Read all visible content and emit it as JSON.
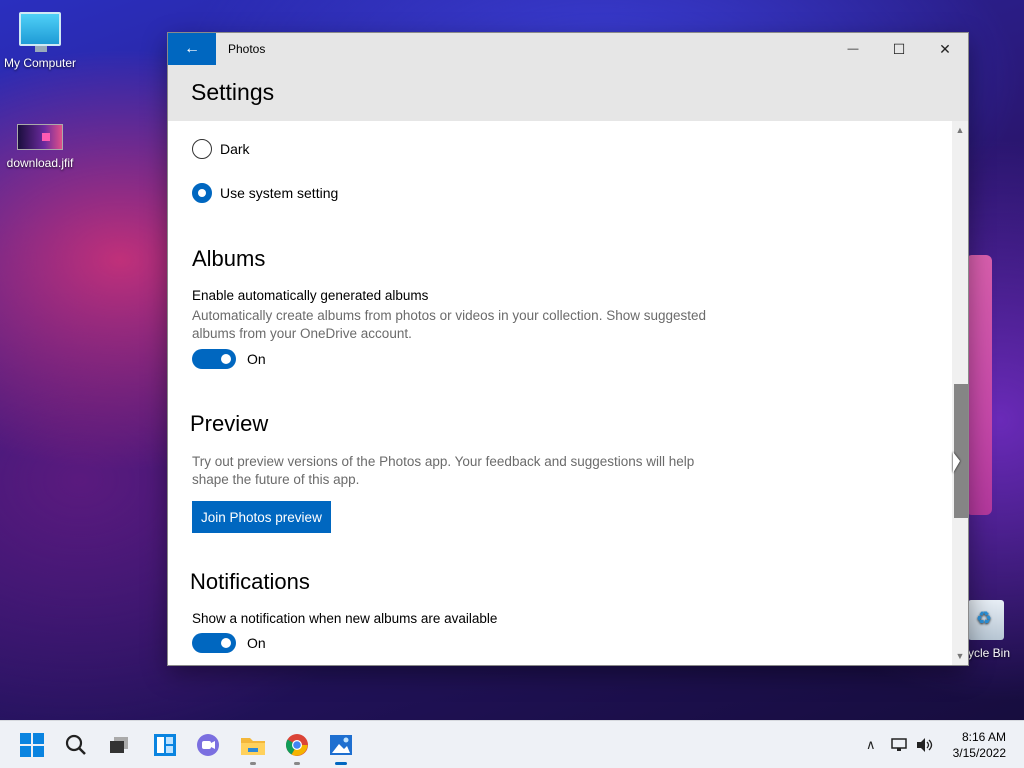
{
  "desktop": {
    "icons": [
      {
        "label": "My Computer"
      },
      {
        "label": "download.jfif"
      },
      {
        "label": "cycle Bin"
      }
    ]
  },
  "window": {
    "title": "Photos",
    "back_icon": "←",
    "minimize_icon": "—",
    "maximize_icon": "☐",
    "close_icon": "✕"
  },
  "settings": {
    "heading": "Settings",
    "theme": {
      "options": [
        {
          "label": "Dark",
          "checked": false
        },
        {
          "label": "Use system setting",
          "checked": true
        }
      ]
    },
    "albums": {
      "title": "Albums",
      "label": "Enable automatically generated albums",
      "description": "Automatically create albums from photos or videos in your collection. Show suggested albums from your OneDrive account.",
      "toggle_state": "On"
    },
    "preview": {
      "title": "Preview",
      "description": "Try out preview versions of the Photos app. Your feedback and suggestions will help shape the future of this app.",
      "button_label": "Join Photos preview"
    },
    "notifications": {
      "title": "Notifications",
      "label": "Show a notification when new albums are available",
      "toggle_state": "On"
    }
  },
  "taskbar": {
    "clock_time": "8:16 AM",
    "clock_date": "3/15/2022",
    "tray_chevron": "∧",
    "accent_color": "#0067c0"
  }
}
